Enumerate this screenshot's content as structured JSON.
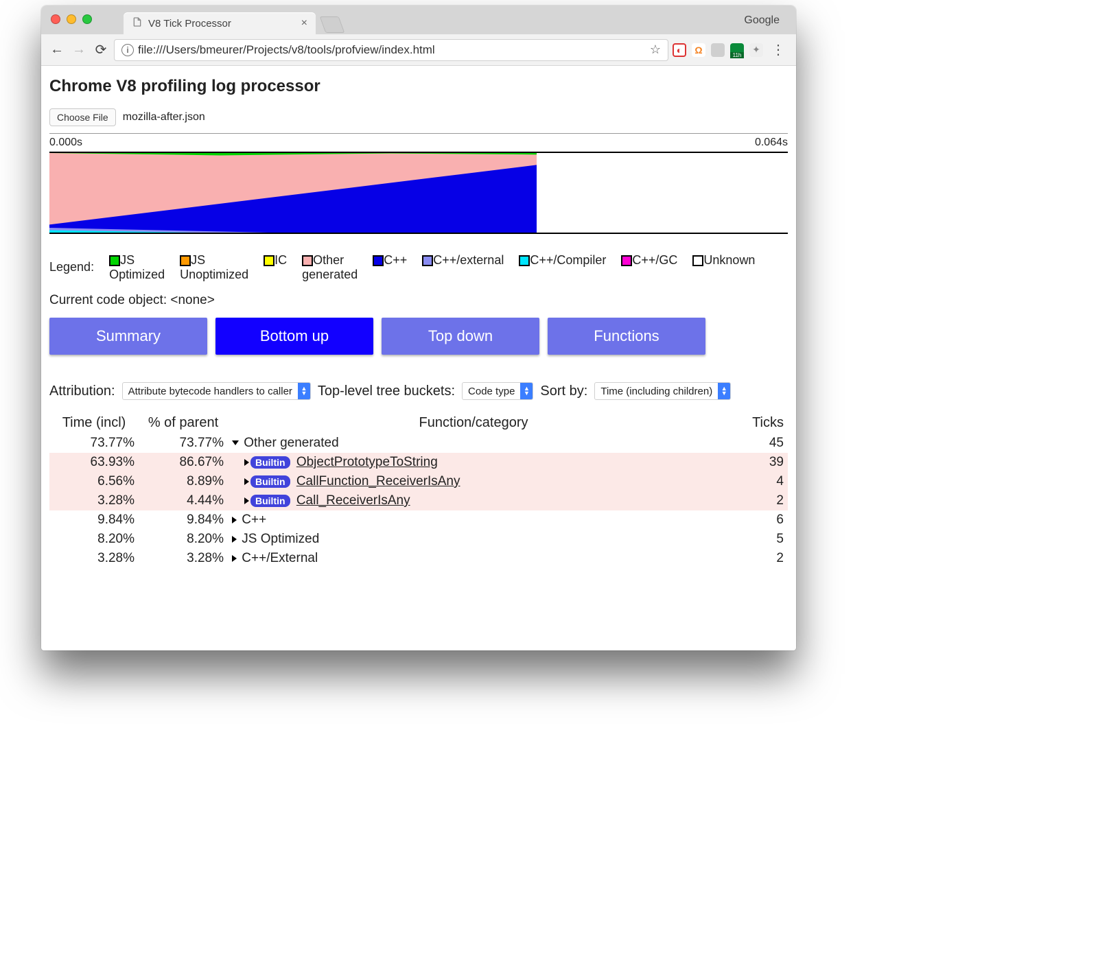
{
  "window": {
    "tab_title": "V8 Tick Processor",
    "google_label": "Google",
    "url": "file:///Users/bmeurer/Projects/v8/tools/profview/index.html"
  },
  "page": {
    "heading": "Chrome V8 profiling log processor",
    "choose_file_label": "Choose File",
    "filename": "mozilla-after.json",
    "time_start": "0.000s",
    "time_end": "0.064s",
    "legend_label": "Legend:",
    "legend": [
      {
        "color": "#00d400",
        "label": "JS\nOptimized"
      },
      {
        "color": "#ff9900",
        "label": "JS\nUnoptimized"
      },
      {
        "color": "#ffff00",
        "label": "IC"
      },
      {
        "color": "#f9b0b0",
        "label": "Other\ngenerated"
      },
      {
        "color": "#0600e6",
        "label": "C++"
      },
      {
        "color": "#8a8cf2",
        "label": "C++/external"
      },
      {
        "color": "#00e5ff",
        "label": "C++/Compiler"
      },
      {
        "color": "#ff00d4",
        "label": "C++/GC"
      },
      {
        "color": "#ffffff",
        "label": "Unknown"
      }
    ],
    "current_object": "Current code object: <none>",
    "tabs": [
      {
        "label": "Summary",
        "active": false
      },
      {
        "label": "Bottom up",
        "active": true
      },
      {
        "label": "Top down",
        "active": false
      },
      {
        "label": "Functions",
        "active": false
      }
    ],
    "attribution_label": "Attribution:",
    "attribution_value": "Attribute bytecode handlers to caller",
    "buckets_label": "Top-level tree buckets:",
    "buckets_value": "Code type",
    "sort_label": "Sort by:",
    "sort_value": "Time (including children)",
    "builtin_badge": "Builtin",
    "columns": {
      "time_incl": "Time (incl)",
      "pct_parent": "% of parent",
      "func": "Function/category",
      "ticks": "Ticks"
    },
    "rows": [
      {
        "time": "73.77%",
        "parent": "73.77%",
        "func": "Other generated",
        "ticks": "45",
        "expanded": true,
        "level": 0,
        "builtin": false,
        "pink": false,
        "underline": false
      },
      {
        "time": "63.93%",
        "parent": "86.67%",
        "func": "ObjectPrototypeToString",
        "ticks": "39",
        "expanded": false,
        "level": 1,
        "builtin": true,
        "pink": true,
        "underline": true
      },
      {
        "time": "6.56%",
        "parent": "8.89%",
        "func": "CallFunction_ReceiverIsAny",
        "ticks": "4",
        "expanded": false,
        "level": 1,
        "builtin": true,
        "pink": true,
        "underline": true
      },
      {
        "time": "3.28%",
        "parent": "4.44%",
        "func": "Call_ReceiverIsAny",
        "ticks": "2",
        "expanded": false,
        "level": 1,
        "builtin": true,
        "pink": true,
        "underline": true
      },
      {
        "time": "9.84%",
        "parent": "9.84%",
        "func": "C++",
        "ticks": "6",
        "expanded": false,
        "level": 0,
        "builtin": false,
        "pink": false,
        "underline": false
      },
      {
        "time": "8.20%",
        "parent": "8.20%",
        "func": "JS Optimized",
        "ticks": "5",
        "expanded": false,
        "level": 0,
        "builtin": false,
        "pink": false,
        "underline": false
      },
      {
        "time": "3.28%",
        "parent": "3.28%",
        "func": "C++/External",
        "ticks": "2",
        "expanded": false,
        "level": 0,
        "builtin": false,
        "pink": false,
        "underline": false
      }
    ]
  },
  "chart_data": {
    "type": "area",
    "xlim": [
      0.0,
      0.064
    ],
    "note": "Stacked-area profiler timeline. Horizontal axis is seconds (0–0.064). Vertical axis is 0–1 fraction of samples. Active profiling data ends around x≈0.042; beyond that the chart is empty (white). Within active region, roughly: pink 'Other generated' dominates the upper half with a thin green 'JS Optimized' strip at the very top; blue 'C++' grows from ~10% at x=0 to ~85% at x≈0.042 as a rising wedge along the bottom; thin cyan and light-purple slivers near the bottom left.",
    "series": [
      {
        "name": "JS Optimized",
        "color": "#00d400"
      },
      {
        "name": "Other generated",
        "color": "#f9b0b0"
      },
      {
        "name": "C++",
        "color": "#0600e6"
      },
      {
        "name": "C++/external",
        "color": "#8a8cf2"
      },
      {
        "name": "C++/Compiler",
        "color": "#00e5ff"
      }
    ]
  }
}
